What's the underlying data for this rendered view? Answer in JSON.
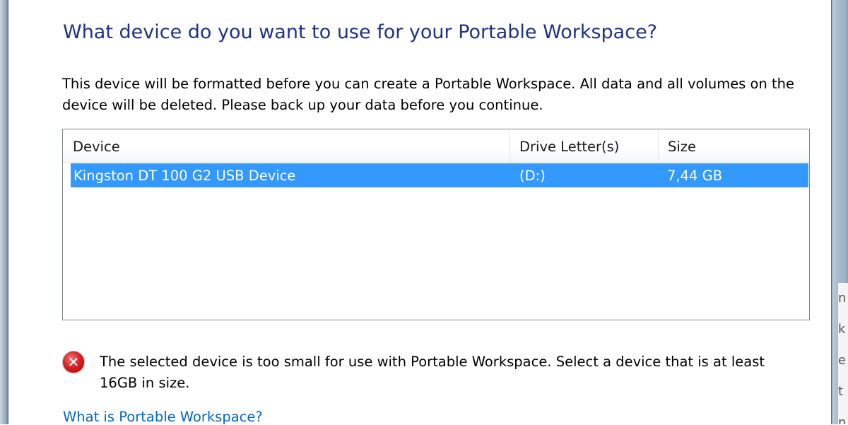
{
  "dialog": {
    "title": "What device do you want to use for your Portable Workspace?",
    "description": "This device will be formatted before you can create a Portable Workspace. All data and all volumes on the device will be deleted. Please back up your data before you continue.",
    "help_link": "What is Portable Workspace?"
  },
  "device_list": {
    "columns": [
      "Device",
      "Drive Letter(s)",
      "Size"
    ],
    "rows": [
      {
        "device": "Kingston DT 100 G2 USB Device",
        "drive_letters": "(D:)",
        "size": "7,44 GB",
        "selected": true
      }
    ]
  },
  "error": {
    "icon": "error-icon",
    "message": "The selected device is too small for use with Portable Workspace. Select a device that is at least 16GB in size."
  },
  "background_peek": [
    "n",
    "k",
    "e",
    "t",
    "n"
  ],
  "colors": {
    "title": "#1e3287",
    "selection": "#3399ff",
    "link": "#0066cc",
    "error": "#d22222"
  }
}
